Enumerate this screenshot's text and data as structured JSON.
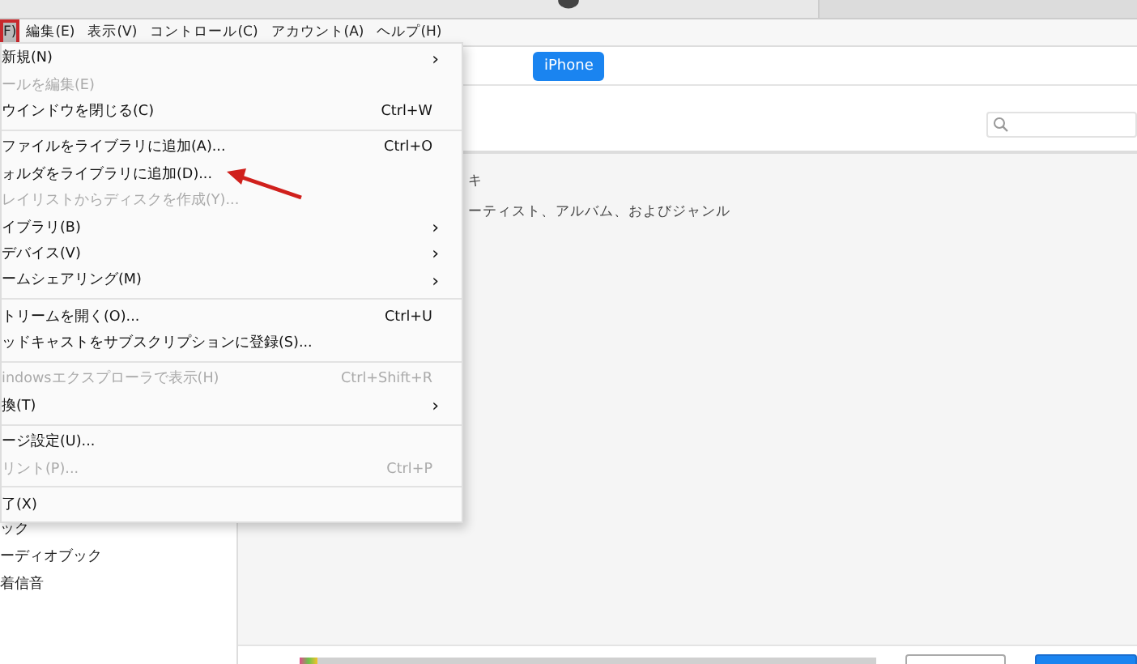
{
  "menubar": [
    {
      "label": "F)",
      "selected": true
    },
    {
      "label": "編集(E)",
      "selected": false
    },
    {
      "label": "表示(V)",
      "selected": false
    },
    {
      "label": "コントロール(C)",
      "selected": false
    },
    {
      "label": "アカウント(A)",
      "selected": false
    },
    {
      "label": "ヘルプ(H)",
      "selected": false
    }
  ],
  "menu": {
    "groups": [
      [
        {
          "label": "新規(N)",
          "submenu": true,
          "disabled": false
        },
        {
          "label": "ールを編集(E)",
          "submenu": false,
          "disabled": true
        },
        {
          "label": "ウインドウを閉じる(C)",
          "shortcut": "Ctrl+W",
          "submenu": false,
          "disabled": false
        }
      ],
      [
        {
          "label": "ファイルをライブラリに追加(A)...",
          "shortcut": "Ctrl+O",
          "submenu": false,
          "disabled": false
        },
        {
          "label": "ォルダをライブラリに追加(D)...",
          "submenu": false,
          "disabled": false
        },
        {
          "label": "レイリストからディスクを作成(Y)...",
          "submenu": false,
          "disabled": true
        },
        {
          "label": "イブラリ(B)",
          "submenu": true,
          "disabled": false
        },
        {
          "label": "デバイス(V)",
          "submenu": true,
          "disabled": false
        },
        {
          "label": "ームシェアリング(M)",
          "submenu": true,
          "disabled": false
        }
      ],
      [
        {
          "label": "トリームを開く(O)...",
          "shortcut": "Ctrl+U",
          "submenu": false,
          "disabled": false
        },
        {
          "label": "ッドキャストをサブスクリプションに登録(S)...",
          "submenu": false,
          "disabled": false
        }
      ],
      [
        {
          "label": "indowsエクスプローラで表示(H)",
          "shortcut": "Ctrl+Shift+R",
          "submenu": false,
          "disabled": true
        },
        {
          "label": "換(T)",
          "submenu": true,
          "disabled": false
        }
      ],
      [
        {
          "label": "ージ設定(U)...",
          "submenu": false,
          "disabled": false
        },
        {
          "label": "リント(P)...",
          "shortcut": "Ctrl+P",
          "submenu": false,
          "disabled": true
        }
      ],
      [
        {
          "label": "了(X)",
          "submenu": false,
          "disabled": false
        }
      ]
    ],
    "submenu_marker": "›"
  },
  "device_button": "iPhone",
  "sidebar": {
    "items": [
      "ック",
      "ーディオブック",
      "着信音"
    ]
  },
  "content": {
    "lines": [
      "キ",
      "ーティスト、アルバム、およびジャンル"
    ]
  }
}
